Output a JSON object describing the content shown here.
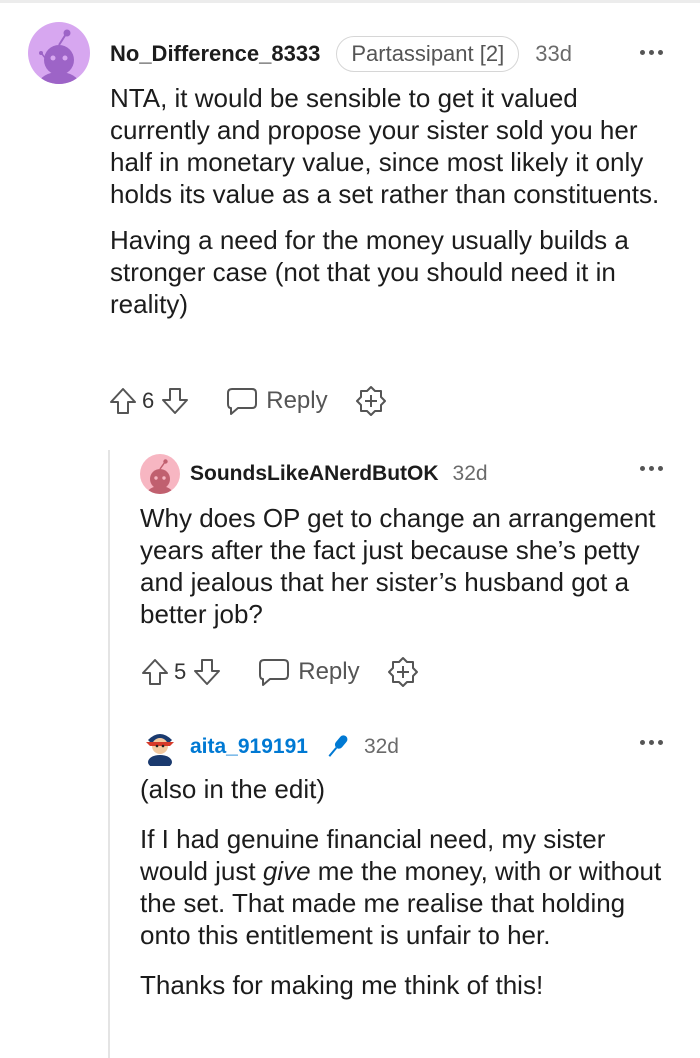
{
  "comments": [
    {
      "username": "No_Difference_8333",
      "flair": "Partassipant [2]",
      "age": "33d",
      "paragraphs": [
        "NTA, it would be sensible to get it valued currently and propose your sister sold you her half in monetary value, since most likely it only holds its value as a set rather than constituents.",
        "Having a need for the money usually builds a stronger case (not that you should need it in reality)"
      ],
      "votes": "6",
      "reply_label": "Reply",
      "avatar_color": "#d7a7f0"
    },
    {
      "username": "SoundsLikeANerdButOK",
      "age": "32d",
      "paragraphs": [
        "Why does OP get to change an arrangement years after the fact just because she’s petty and jealous that her sister’s husband got a better job?"
      ],
      "votes": "5",
      "reply_label": "Reply",
      "avatar_color": "#f7b6c2"
    },
    {
      "username": "aita_919191",
      "age": "32d",
      "paragraphs": [
        "(also in the edit)",
        "If I had genuine financial need, my sister would just give me the money, with or without the set. That made me realise that holding onto this entitlement is unfair to her.",
        "Thanks for making me think of this!"
      ],
      "paragraph_emphasis_word": "give",
      "username_color": "#0079d3"
    }
  ]
}
